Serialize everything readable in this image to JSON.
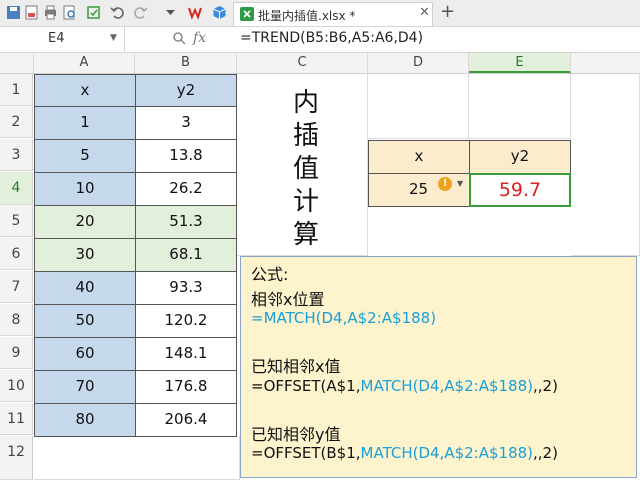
{
  "toolbar": {
    "icons": [
      "save-icon",
      "export-icon",
      "print-icon",
      "preview-icon",
      "undo-icon",
      "redo-icon",
      "dropdown-icon",
      "wps-logo-icon",
      "cube-icon"
    ],
    "tab_label": "批量内插值.xlsx *",
    "tab_close": "✕",
    "new_tab": "+"
  },
  "formula_bar": {
    "cell_ref": "E4",
    "fx": "fx",
    "formula": "=TREND(B5:B6,A5:A6,D4)"
  },
  "columns": [
    "A",
    "B",
    "C",
    "D",
    "E"
  ],
  "rows": [
    "1",
    "2",
    "3",
    "4",
    "5",
    "6",
    "7",
    "8",
    "9",
    "10",
    "11",
    "12"
  ],
  "table": {
    "header": [
      "x",
      "y2"
    ],
    "rows": [
      [
        "1",
        "3"
      ],
      [
        "5",
        "13.8"
      ],
      [
        "10",
        "26.2"
      ],
      [
        "20",
        "51.3"
      ],
      [
        "30",
        "68.1"
      ],
      [
        "40",
        "93.3"
      ],
      [
        "50",
        "120.2"
      ],
      [
        "60",
        "148.1"
      ],
      [
        "70",
        "176.8"
      ],
      [
        "80",
        "206.4"
      ]
    ]
  },
  "title_chars": [
    "内",
    "插",
    "值",
    "计",
    "算"
  ],
  "calc": {
    "header": [
      "x",
      "y2"
    ],
    "x_value": "25",
    "result": "59.7",
    "warn_symbol": "!"
  },
  "note": {
    "line1": "公式:",
    "line2": "相邻x位置",
    "line3": "=MATCH(D4,A$2:A$188)",
    "line4": "已知相邻x值",
    "line5_a": "=OFFSET(A$1,",
    "line5_b": "MATCH(D4,A$2:A$188)",
    "line5_c": ",,2)",
    "line6": "已知相邻y值",
    "line7_a": "=OFFSET(B$1,",
    "line7_b": "MATCH(D4,A$2:A$188)",
    "line7_c": ",,2)"
  },
  "colors": {
    "selection": "#3a9b3a",
    "result_text": "#e02020",
    "formula_cyan": "#1aa0d8",
    "note_bg": "#fdf3cd",
    "blue_cell": "#c6d9ec",
    "green_cell": "#e2efdb"
  }
}
